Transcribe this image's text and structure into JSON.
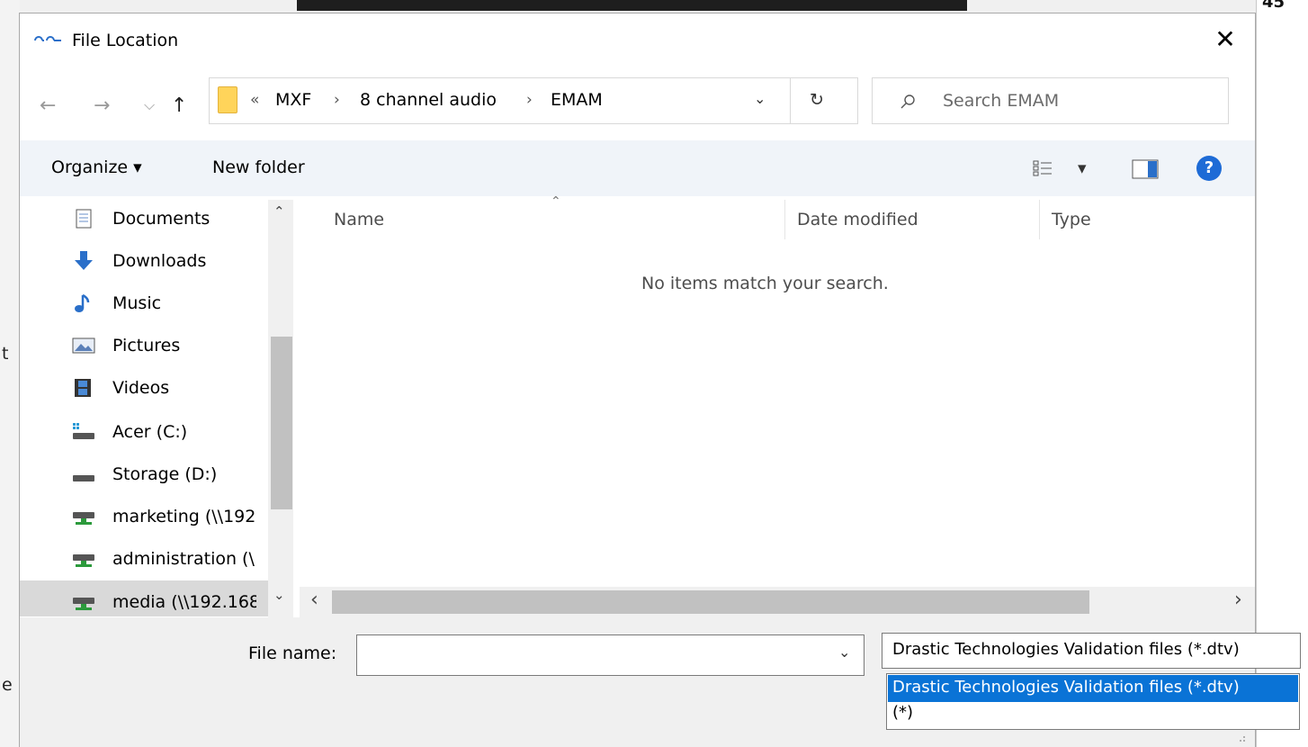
{
  "background": {
    "corner_number": "45",
    "left_fragments": [
      "t",
      "e"
    ]
  },
  "dialog": {
    "title": "File Location",
    "close_glyph": "✕"
  },
  "navigation": {
    "back_glyph": "←",
    "forward_glyph": "→",
    "recent_glyph": "⌵",
    "up_glyph": "↑"
  },
  "address_bar": {
    "overflow": "«",
    "separator": "›",
    "crumbs": [
      "MXF",
      "8 channel audio",
      "EMAM"
    ],
    "dropdown_glyph": "⌄",
    "refresh_glyph": "↻"
  },
  "search": {
    "placeholder": "Search EMAM",
    "icon": "search-icon"
  },
  "toolbar": {
    "organize": "Organize ▾",
    "new_folder": "New folder",
    "view_dropdown": "▾",
    "help": "?"
  },
  "nav_pane": {
    "items": [
      {
        "label": "Documents",
        "icon": "documents-icon"
      },
      {
        "label": "Downloads",
        "icon": "downloads-icon"
      },
      {
        "label": "Music",
        "icon": "music-icon"
      },
      {
        "label": "Pictures",
        "icon": "pictures-icon"
      },
      {
        "label": "Videos",
        "icon": "videos-icon"
      },
      {
        "label": "Acer (C:)",
        "icon": "drive-c-icon"
      },
      {
        "label": "Storage (D:)",
        "icon": "drive-icon"
      },
      {
        "label": "marketing (\\\\192",
        "icon": "network-drive-icon"
      },
      {
        "label": "administration (\\",
        "icon": "network-drive-icon"
      },
      {
        "label": "media (\\\\192.168",
        "icon": "network-drive-icon"
      }
    ],
    "scroll_up": "⌃",
    "scroll_down": "⌄"
  },
  "file_list": {
    "columns": [
      "Name",
      "Date modified",
      "Type"
    ],
    "sort_indicator": "⌃",
    "empty_message": "No items match your search.",
    "scroll_left": "‹",
    "scroll_right": "›"
  },
  "footer": {
    "file_name_label": "File name:",
    "file_name_value": "",
    "file_name_dropdown": "⌄",
    "file_type_selected": "Drastic Technologies Validation files (*.dtv)",
    "file_type_options": [
      "Drastic Technologies Validation files (*.dtv)",
      "(*)"
    ]
  },
  "colors": {
    "selection": "#0a73d6",
    "help_blue": "#1e6bd6",
    "folder": "#ffd45a",
    "toolbar_bg": "#f0f4f9"
  }
}
